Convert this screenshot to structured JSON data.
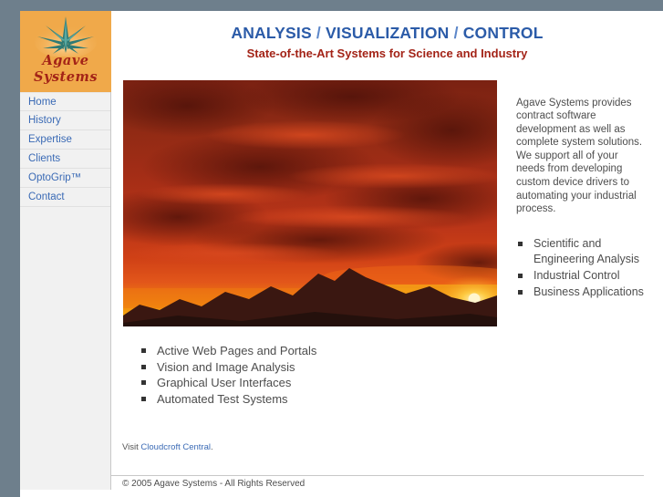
{
  "site": {
    "logo": {
      "icon": "agave-plant-icon",
      "line1": "Agave",
      "line2": "Systems",
      "box_color": "#f0a94a",
      "text_color": "#a32317",
      "plant_color": "#3f8c86"
    },
    "background_color": "#6e7f8c",
    "page_color": "#ffffff"
  },
  "nav": {
    "items": [
      {
        "label": "Home"
      },
      {
        "label": "History"
      },
      {
        "label": "Expertise"
      },
      {
        "label": "Clients"
      },
      {
        "label": "OptoGrip™"
      },
      {
        "label": "Contact"
      }
    ],
    "link_color": "#3a6ab5"
  },
  "header": {
    "headline_part1": "ANALYSIS",
    "headline_sep1": " / ",
    "headline_part2": "VISUALIZATION",
    "headline_sep2": " / ",
    "headline_part3": "CONTROL",
    "subhead": "State-of-the-Art Systems for Science and Industry",
    "headline_color": "#2b5ba8",
    "subhead_color": "#a32317"
  },
  "photo": {
    "alt": "Red sunset over mountain silhouettes",
    "sky_top_color": "#6e1b0f",
    "sky_mid_color": "#c4341a",
    "glow_color": "#f5a210",
    "sun_color": "#ffe9a8",
    "mountain_color": "#3b1610"
  },
  "main": {
    "intro_paragraph": "Agave Systems provides contract software development as well as complete system solutions. We support all of your needs from developing custom device drivers to automating your industrial process.",
    "right_list": [
      "Scientific and Engineering Analysis",
      "Industrial Control",
      "Business Applications"
    ],
    "lower_list": [
      "Active Web Pages and Portals",
      "Vision and Image Analysis",
      "Graphical User Interfaces",
      "Automated Test Systems"
    ]
  },
  "visit": {
    "prefix": "Visit ",
    "link_label": "Cloudcroft Central",
    "suffix": "."
  },
  "footer": {
    "copyright": "© 2005 Agave Systems - All Rights Reserved"
  }
}
